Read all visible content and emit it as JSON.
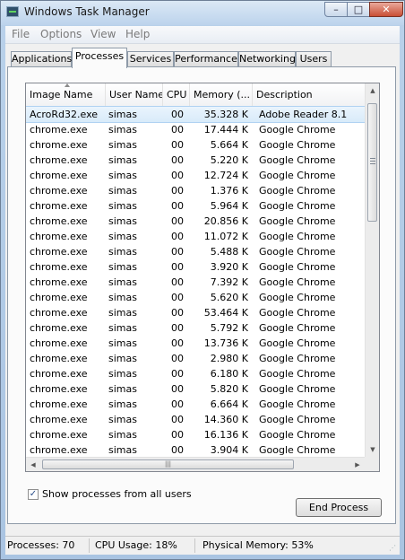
{
  "window": {
    "title": "Windows Task Manager"
  },
  "caption": {
    "minimize": "–",
    "maximize": "□",
    "close": "✕"
  },
  "menu": [
    "File",
    "Options",
    "View",
    "Help"
  ],
  "tabs": [
    "Applications",
    "Processes",
    "Services",
    "Performance",
    "Networking",
    "Users"
  ],
  "active_tab": "Processes",
  "columns": [
    "Image Name",
    "User Name",
    "CPU",
    "Memory (...",
    "Description"
  ],
  "processes": [
    {
      "name": "AcroRd32.exe",
      "user": "simas",
      "cpu": "00",
      "memory": "35.328 K",
      "desc": "Adobe Reader 8.1"
    },
    {
      "name": "chrome.exe",
      "user": "simas",
      "cpu": "00",
      "memory": "17.444 K",
      "desc": "Google Chrome"
    },
    {
      "name": "chrome.exe",
      "user": "simas",
      "cpu": "00",
      "memory": "5.664 K",
      "desc": "Google Chrome"
    },
    {
      "name": "chrome.exe",
      "user": "simas",
      "cpu": "00",
      "memory": "5.220 K",
      "desc": "Google Chrome"
    },
    {
      "name": "chrome.exe",
      "user": "simas",
      "cpu": "00",
      "memory": "12.724 K",
      "desc": "Google Chrome"
    },
    {
      "name": "chrome.exe",
      "user": "simas",
      "cpu": "00",
      "memory": "1.376 K",
      "desc": "Google Chrome"
    },
    {
      "name": "chrome.exe",
      "user": "simas",
      "cpu": "00",
      "memory": "5.964 K",
      "desc": "Google Chrome"
    },
    {
      "name": "chrome.exe",
      "user": "simas",
      "cpu": "00",
      "memory": "20.856 K",
      "desc": "Google Chrome"
    },
    {
      "name": "chrome.exe",
      "user": "simas",
      "cpu": "00",
      "memory": "11.072 K",
      "desc": "Google Chrome"
    },
    {
      "name": "chrome.exe",
      "user": "simas",
      "cpu": "00",
      "memory": "5.488 K",
      "desc": "Google Chrome"
    },
    {
      "name": "chrome.exe",
      "user": "simas",
      "cpu": "00",
      "memory": "3.920 K",
      "desc": "Google Chrome"
    },
    {
      "name": "chrome.exe",
      "user": "simas",
      "cpu": "00",
      "memory": "7.392 K",
      "desc": "Google Chrome"
    },
    {
      "name": "chrome.exe",
      "user": "simas",
      "cpu": "00",
      "memory": "5.620 K",
      "desc": "Google Chrome"
    },
    {
      "name": "chrome.exe",
      "user": "simas",
      "cpu": "00",
      "memory": "53.464 K",
      "desc": "Google Chrome"
    },
    {
      "name": "chrome.exe",
      "user": "simas",
      "cpu": "00",
      "memory": "5.792 K",
      "desc": "Google Chrome"
    },
    {
      "name": "chrome.exe",
      "user": "simas",
      "cpu": "00",
      "memory": "13.736 K",
      "desc": "Google Chrome"
    },
    {
      "name": "chrome.exe",
      "user": "simas",
      "cpu": "00",
      "memory": "2.980 K",
      "desc": "Google Chrome"
    },
    {
      "name": "chrome.exe",
      "user": "simas",
      "cpu": "00",
      "memory": "6.180 K",
      "desc": "Google Chrome"
    },
    {
      "name": "chrome.exe",
      "user": "simas",
      "cpu": "00",
      "memory": "5.820 K",
      "desc": "Google Chrome"
    },
    {
      "name": "chrome.exe",
      "user": "simas",
      "cpu": "00",
      "memory": "6.664 K",
      "desc": "Google Chrome"
    },
    {
      "name": "chrome.exe",
      "user": "simas",
      "cpu": "00",
      "memory": "14.360 K",
      "desc": "Google Chrome"
    },
    {
      "name": "chrome.exe",
      "user": "simas",
      "cpu": "00",
      "memory": "16.136 K",
      "desc": "Google Chrome"
    },
    {
      "name": "chrome.exe",
      "user": "simas",
      "cpu": "00",
      "memory": "3.904 K",
      "desc": "Google Chrome"
    },
    {
      "name": "chrome.exe",
      "user": "simas",
      "cpu": "00",
      "memory": "6.652 K",
      "desc": "Google Chrome"
    }
  ],
  "checkbox": {
    "label": "Show processes from all users",
    "checked": true,
    "mark": "✓"
  },
  "end_process_label": "End Process",
  "status": {
    "processes": "Processes: 70",
    "cpu": "CPU Usage: 18%",
    "memory": "Physical Memory: 53%"
  },
  "colors": {
    "selection": "#d8ebfa",
    "title_gradient_top": "#dbe8f5",
    "close_button": "#c94f35"
  }
}
